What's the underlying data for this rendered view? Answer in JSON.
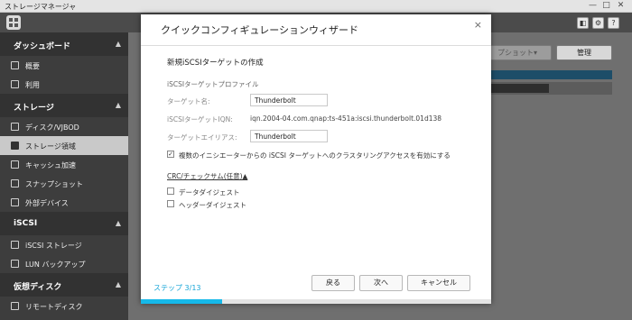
{
  "window": {
    "title": "ストレージマネージャ",
    "minimize": "—",
    "maximize": "□",
    "close": "✕"
  },
  "toolbar": {
    "home_icon": "grid-app-icon",
    "right_icons": [
      "storage-icon",
      "gear-icon",
      "help-icon"
    ],
    "right_glyphs": [
      "◧",
      "⚙",
      "?"
    ]
  },
  "sidebar": {
    "sections": [
      {
        "label": "ダッシュボード",
        "items": [
          {
            "label": "概要",
            "icon": "overview-icon"
          },
          {
            "label": "利用",
            "icon": "usage-icon"
          }
        ]
      },
      {
        "label": "ストレージ",
        "items": [
          {
            "label": "ディスク/VJBOD",
            "icon": "disk-icon"
          },
          {
            "label": "ストレージ領域",
            "icon": "storage-space-icon"
          },
          {
            "label": "キャッシュ加速",
            "icon": "cache-icon"
          },
          {
            "label": "スナップショット",
            "icon": "snapshot-icon"
          },
          {
            "label": "外部デバイス",
            "icon": "external-device-icon"
          }
        ]
      },
      {
        "label": "iSCSI",
        "items": [
          {
            "label": "iSCSI ストレージ",
            "icon": "iscsi-storage-icon"
          },
          {
            "label": "LUN バックアップ",
            "icon": "lun-backup-icon"
          }
        ]
      },
      {
        "label": "仮想ディスク",
        "items": [
          {
            "label": "リモートディスク",
            "icon": "remote-disk-icon"
          }
        ]
      }
    ],
    "active": "ストレージ領域",
    "chevron": "▲"
  },
  "main": {
    "snapshot_button": "プショット▾",
    "manage_button": "管理",
    "usage_fraction": 0.5
  },
  "dialog": {
    "title": "クイックコンフィギュレーションウィザード",
    "close": "×",
    "subtitle": "新規iSCSIターゲットの作成",
    "profile_label": "iSCSIターゲットプロファイル",
    "target_name_label": "ターゲット名:",
    "target_name_value": "Thunderbolt",
    "iqn_label": "iSCSIターゲットIQN:",
    "iqn_value": "iqn.2004-04.com.qnap:ts-451a:iscsi.thunderbolt.01d138",
    "alias_label": "ターゲットエイリアス:",
    "alias_value": "Thunderbolt",
    "clustering_label": "複数のイニシエーターからの iSCSI ターゲットへのクラスタリングアクセスを有効にする",
    "clustering_checked": true,
    "crc_label": "CRC/チェックサム(任意)▲",
    "data_digest_label": "データダイジェスト",
    "data_digest_checked": false,
    "header_digest_label": "ヘッダーダイジェスト",
    "header_digest_checked": false,
    "step_text": "ステップ 3/13",
    "step_current": 3,
    "step_total": 13,
    "back_button": "戻る",
    "next_button": "次へ",
    "cancel_button": "キャンセル"
  },
  "colors": {
    "accent": "#16b9e9",
    "sidebar_bg": "#3d3d3d",
    "active_item": "#c9c9c9"
  }
}
